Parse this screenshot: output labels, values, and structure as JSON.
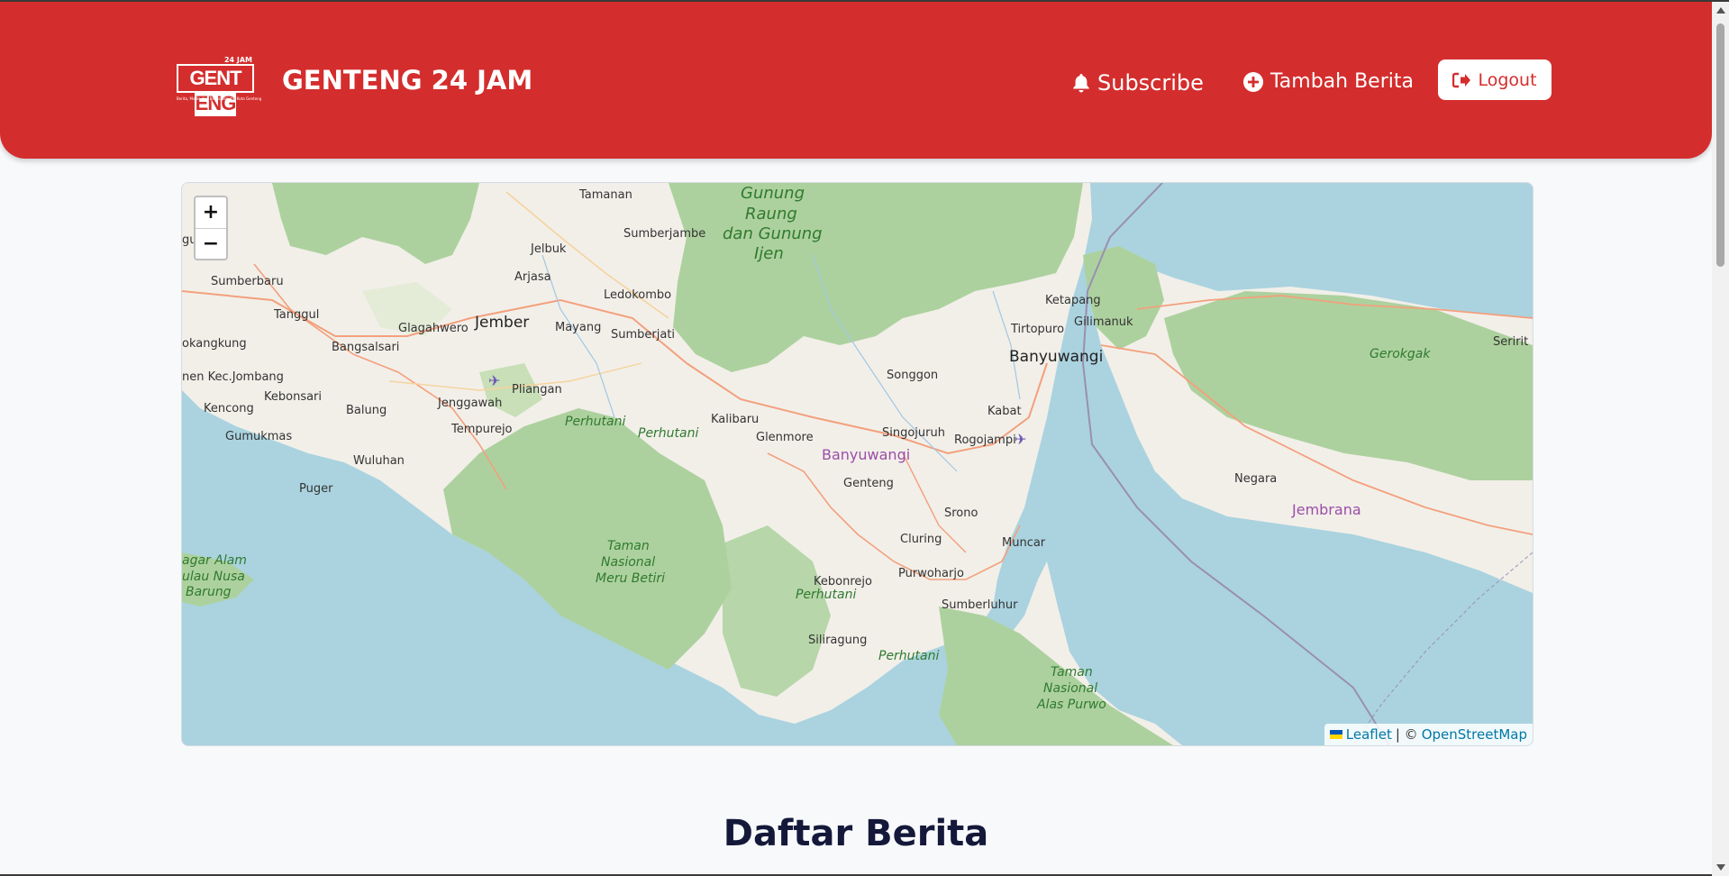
{
  "header": {
    "logo_top": "24 JAM",
    "logo_main_left": "GENT",
    "logo_main_right": "ENG",
    "logo_tagline": "Berita, Media dan Berita Seputar Kota Genteng",
    "title": "GENTENG 24 JAM",
    "subscribe_label": "Subscribe",
    "tambah_label": "Tambah Berita",
    "logout_label": "Logout"
  },
  "map": {
    "zoom_in": "+",
    "zoom_out": "−",
    "attribution_leaflet": "Leaflet",
    "attribution_sep": "| ©",
    "attribution_osm": "OpenStreetMap",
    "labels": {
      "tamanan": "Tamanan",
      "gunung1": "Gunung",
      "gunung2": "Raung",
      "gunung3": "dan Gunung",
      "gunung4": "Ijen",
      "sumberjambe": "Sumberjambe",
      "jelbuk": "Jelbuk",
      "sumberbaru": "Sumberbaru",
      "arjasa": "Arjasa",
      "ledokombo": "Ledokombo",
      "ketapang": "Ketapang",
      "tanggul": "Tanggul",
      "glagahwero": "Glagahwero",
      "jember": "Jember",
      "mayang": "Mayang",
      "sumberjati": "Sumberjati",
      "tirtopuro": "Tirtopuro",
      "gilimanuk": "Gilimanuk",
      "kangkung": "okangkung",
      "bangsalsari": "Bangsalsari",
      "banyuwangi": "Banyuwangi",
      "gerokgak": "Gerokgak",
      "seririt": "Seririt",
      "songgon": "Songgon",
      "kecjombang": "nen Kec.Jombang",
      "kebonsari": "Kebonsari",
      "pliangan": "Pliangan",
      "jenggawah": "Jenggawah",
      "kencong": "Kencong",
      "balung": "Balung",
      "kabat": "Kabat",
      "perhutani1": "Perhutani",
      "kalibaru": "Kalibaru",
      "perhutani2": "Perhutani",
      "tempurejo": "Tempurejo",
      "gumukmas": "Gumukmas",
      "glenmore": "Glenmore",
      "singojuruh": "Singojuruh",
      "rogojampi": "Rogojampi",
      "banyuwangi_region": "Banyuwangi",
      "wuluhan": "Wuluhan",
      "negara": "Negara",
      "genteng": "Genteng",
      "puger": "Puger",
      "jembrana": "Jembrana",
      "srono": "Srono",
      "taman1": "Taman",
      "taman2": "Nasional",
      "taman3": "Meru Betiri",
      "cluring": "Cluring",
      "muncar": "Muncar",
      "cagar1": "agar Alam",
      "cagar2": "ulau Nusa",
      "cagar3": "Barung",
      "purwoharjo": "Purwoharjo",
      "kebonrejo": "Kebonrejo",
      "perhutani3": "Perhutani",
      "sumberluhur": "Sumberluhur",
      "siliragung": "Siliragung",
      "perhutani4": "Perhutani",
      "alas1": "Taman",
      "alas2": "Nasional",
      "alas3": "Alas Purwo",
      "gu": "gu"
    }
  },
  "main": {
    "section_title": "Daftar Berita"
  },
  "colors": {
    "header_bg": "#d42d2d",
    "sea": "#aad3df",
    "land": "#f2efe9",
    "forest": "#add19e",
    "title": "#14193a"
  }
}
